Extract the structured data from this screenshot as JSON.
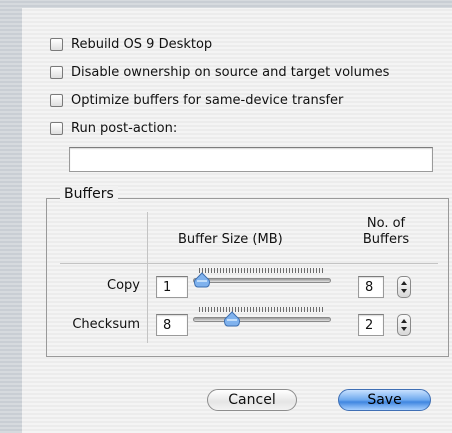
{
  "options": [
    {
      "label": "Rebuild OS 9 Desktop",
      "checked": false
    },
    {
      "label": "Disable ownership on source and target volumes",
      "checked": false
    },
    {
      "label": "Optimize buffers for same-device transfer",
      "checked": false
    },
    {
      "label": "Run post-action:",
      "checked": false
    }
  ],
  "post_action": {
    "value": ""
  },
  "buffers": {
    "title": "Buffers",
    "col_size": "Buffer Size (MB)",
    "col_count_line1": "No. of",
    "col_count_line2": "Buffers",
    "rows": [
      {
        "label": "Copy",
        "size": "1",
        "slider_level": 0.0,
        "count": "8"
      },
      {
        "label": "Checksum",
        "size": "8",
        "slider_level": 0.25,
        "count": "2"
      }
    ]
  },
  "buttons": {
    "cancel": "Cancel",
    "save": "Save"
  },
  "colors": {
    "accent": "#5b9be6"
  }
}
